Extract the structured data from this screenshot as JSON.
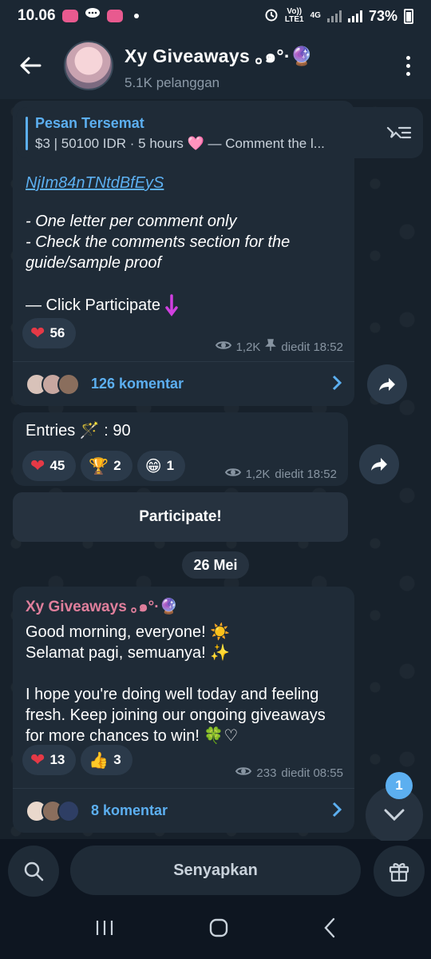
{
  "status_bar": {
    "time": "10.06",
    "network_top": "Vo))",
    "network_bottom": "LTE1",
    "network_type": "4G",
    "battery": "73%"
  },
  "header": {
    "title": "Xy Giveaways ｡๑°·🔮",
    "subtitle": "5.1K pelanggan"
  },
  "pinned": {
    "label": "Pesan Tersemat",
    "text": "$3 | 50100 IDR · 5 hours 🩷 — Comment the l..."
  },
  "post1": {
    "link_line1": "NjIm84nTNtdBfEyS",
    "line_one_letter": "- One letter per comment only",
    "line_check": "- Check the comments section for the guide/sample proof",
    "click_participate": "— Click Participate",
    "reaction_heart_count": "56",
    "views": "1,2K",
    "edited": "diedit 18:52",
    "comments": "126 komentar"
  },
  "post2": {
    "entries_label": "Entries 🪄 : 90",
    "reactions": [
      {
        "emoji": "❤️",
        "count": "45"
      },
      {
        "emoji": "🏆",
        "count": "2"
      },
      {
        "emoji": "😁",
        "count": "1"
      }
    ],
    "views": "1,2K",
    "edited": "diedit 18:52"
  },
  "participate_button": "Participate!",
  "date_chip": "26 Mei",
  "post3": {
    "sender": "Xy Giveaways ｡๑°·🔮",
    "line1": "Good morning, everyone! ☀️",
    "line2": "Selamat pagi, semuanya! ✨",
    "line3": "I hope you're doing well today and feeling fresh. Keep joining our ongoing giveaways for more chances to win! 🍀♡",
    "reactions": [
      {
        "emoji": "❤️",
        "count": "13"
      },
      {
        "emoji": "👍",
        "count": "3"
      }
    ],
    "views": "233",
    "edited": "diedit 08:55",
    "comments": "8 komentar"
  },
  "unread_badge": "1",
  "bottom": {
    "mute_label": "Senyapkan"
  },
  "colors": {
    "accent": "#5caff0",
    "sender": "#e07f9c",
    "bubble": "#1f2b37",
    "background": "#0e1621"
  }
}
